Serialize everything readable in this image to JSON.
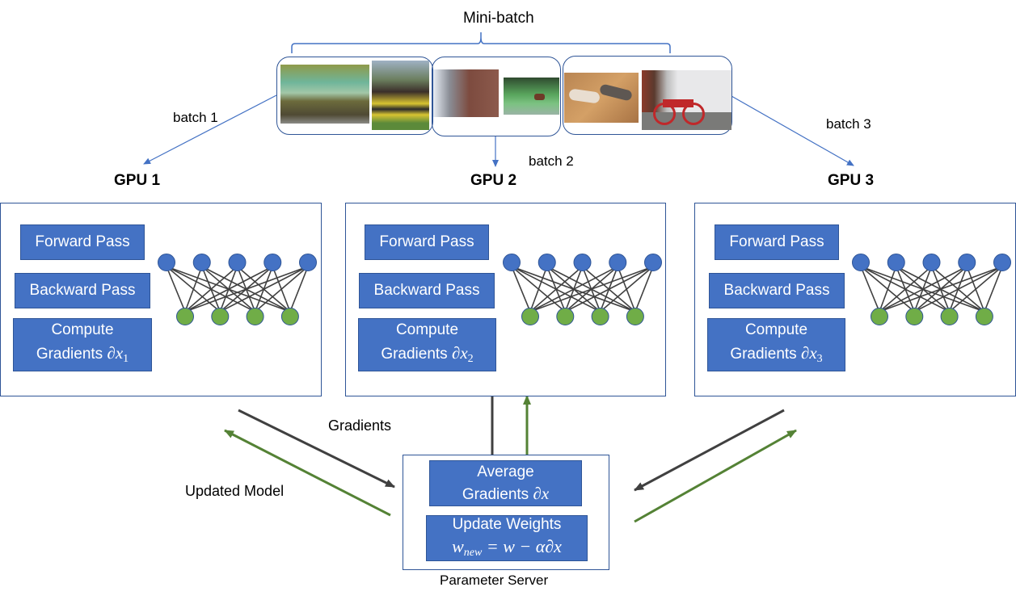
{
  "title": "Mini-batch",
  "batches": [
    {
      "label": "batch 1",
      "images": [
        "house-glass-extension-photo",
        "horse-jumping-photo"
      ]
    },
    {
      "label": "batch 2",
      "images": [
        "street-buildings-photo",
        "cow-under-tree-photo"
      ]
    },
    {
      "label": "batch 3",
      "images": [
        "two-cats-on-floor-photo",
        "red-bicycle-photo"
      ]
    }
  ],
  "gpus": [
    {
      "title": "GPU 1",
      "forward": "Forward Pass",
      "backward": "Backward Pass",
      "compute_line1": "Compute",
      "compute_line2": "Gradients",
      "grad_symbol": "∂x",
      "grad_sub": "1"
    },
    {
      "title": "GPU 2",
      "forward": "Forward Pass",
      "backward": "Backward Pass",
      "compute_line1": "Compute",
      "compute_line2": "Gradients",
      "grad_symbol": "∂x",
      "grad_sub": "2"
    },
    {
      "title": "GPU 3",
      "forward": "Forward Pass",
      "backward": "Backward Pass",
      "compute_line1": "Compute",
      "compute_line2": "Gradients",
      "grad_symbol": "∂x",
      "grad_sub": "3"
    }
  ],
  "network": {
    "input_nodes": 5,
    "output_nodes": 4
  },
  "flows": {
    "gradients_label": "Gradients",
    "updated_model_label": "Updated Model"
  },
  "parameter_server": {
    "label": "Parameter Server",
    "average_line1": "Average",
    "average_line2": "Gradients",
    "average_symbol": "∂x",
    "update_line1": "Update Weights",
    "update_formula_w": "w",
    "update_formula_sub": "new",
    "update_formula_rest": " = w − α∂x"
  },
  "colors": {
    "box_blue": "#4472c4",
    "border_blue": "#2f5597",
    "arrow_blue": "#4472c4",
    "input_node": "#4472c4",
    "output_node": "#70ad47",
    "gradient_arrow": "#404040",
    "update_arrow": "#548235"
  }
}
